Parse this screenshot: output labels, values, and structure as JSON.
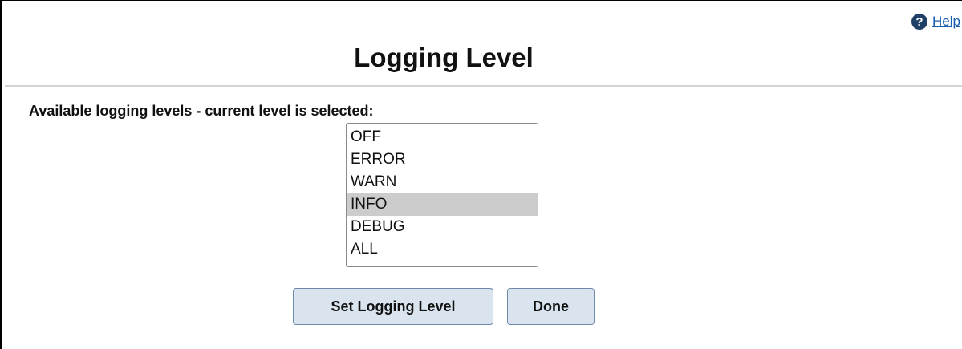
{
  "help": {
    "label": "Help",
    "icon": "question-circle-icon",
    "icon_color": "#1f3f66"
  },
  "page": {
    "title": "Logging Level"
  },
  "form": {
    "prompt": "Available logging levels - current level is selected:",
    "levels": [
      "OFF",
      "ERROR",
      "WARN",
      "INFO",
      "DEBUG",
      "ALL"
    ],
    "selected": "INFO",
    "selected_highlight": "#cccccc"
  },
  "buttons": {
    "set_label": "Set Logging Level",
    "done_label": "Done",
    "background": "#d9e4ee"
  }
}
